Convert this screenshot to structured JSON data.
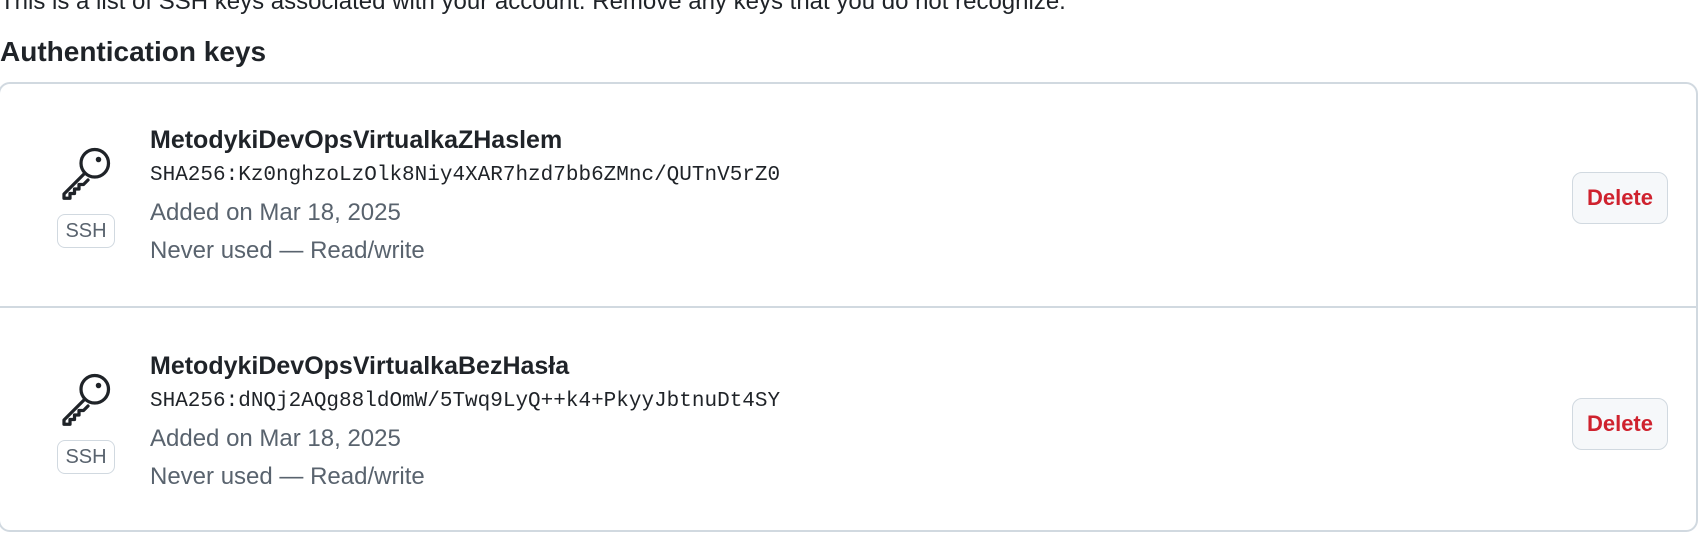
{
  "page": {
    "intro_text": "This is a list of SSH keys associated with your account. Remove any keys that you do not recognize.",
    "section_title": "Authentication keys"
  },
  "keys": [
    {
      "title": "MetodykiDevOpsVirtualkaZHaslem",
      "fingerprint": "SHA256:Kz0nghzoLzOlk8Niy4XAR7hzd7bb6ZMnc/QUTnV5rZ0",
      "added": "Added on Mar 18, 2025",
      "usage": "Never used — Read/write",
      "badge": "SSH",
      "icon": "key-icon",
      "delete_label": "Delete"
    },
    {
      "title": "MetodykiDevOpsVirtualkaBezHasła",
      "fingerprint": "SHA256:dNQj2AQg88ldOmW/5Twq9LyQ++k4+PkyyJbtnuDt4SY",
      "added": "Added on Mar 18, 2025",
      "usage": "Never used — Read/write",
      "badge": "SSH",
      "icon": "key-icon",
      "delete_label": "Delete"
    }
  ],
  "colors": {
    "danger": "#cf222e",
    "border": "#d1d9e0",
    "muted_text": "#59636e",
    "text": "#1f2328"
  }
}
